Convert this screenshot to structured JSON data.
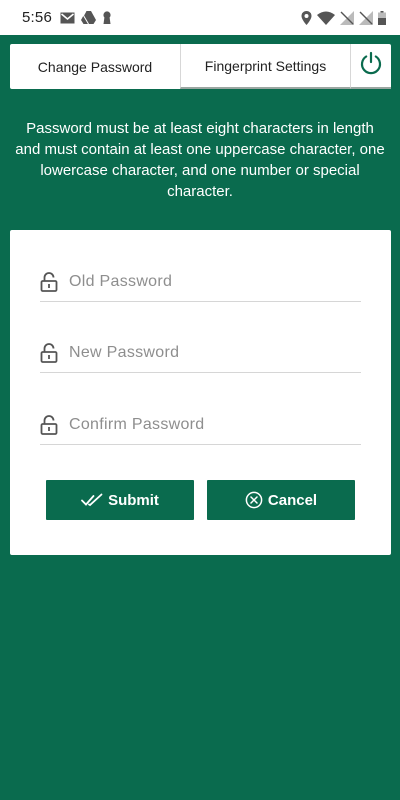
{
  "status_bar": {
    "time": "5:56",
    "left_icons": [
      "gmail-icon",
      "drive-icon",
      "keyhole-icon"
    ],
    "right_icons": [
      "location-icon",
      "wifi-icon",
      "signal-off-icon",
      "signal-off-icon",
      "battery-icon"
    ]
  },
  "tabs": {
    "change_password": "Change Password",
    "fingerprint_settings": "Fingerprint Settings",
    "power_icon": "power-icon"
  },
  "info_text": "Password must be at least eight characters in length and must contain at least one uppercase character, one lowercase character, and one number or special character.",
  "form": {
    "old_password": {
      "placeholder": "Old Password",
      "value": ""
    },
    "new_password": {
      "placeholder": "New Password",
      "value": ""
    },
    "confirm_password": {
      "placeholder": "Confirm Password",
      "value": ""
    },
    "submit_label": "Submit",
    "cancel_label": "Cancel"
  },
  "colors": {
    "primary": "#0a6b4e",
    "background": "#0a6b4e",
    "card": "#ffffff"
  }
}
